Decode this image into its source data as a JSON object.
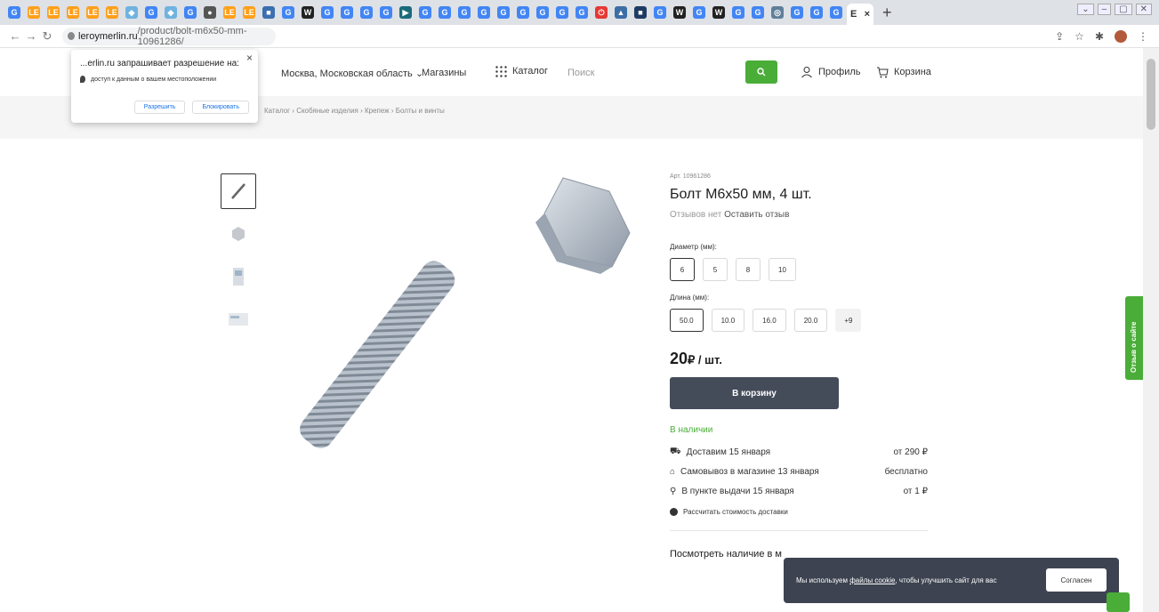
{
  "browser": {
    "tabs": [
      {
        "icon": "google-icon",
        "letter": "G",
        "color": "#4285f4"
      },
      {
        "icon": "leroy-icon",
        "letter": "LE",
        "color": "#ff9f1a"
      },
      {
        "icon": "leroy-icon",
        "letter": "LE",
        "color": "#ff9f1a"
      },
      {
        "icon": "leroy-icon",
        "letter": "LE",
        "color": "#ff9f1a"
      },
      {
        "icon": "leroy-icon",
        "letter": "LE",
        "color": "#ff9f1a"
      },
      {
        "icon": "leroy-icon",
        "letter": "LE",
        "color": "#ff9f1a"
      },
      {
        "icon": "gem-icon",
        "letter": "◆",
        "color": "#6fb3e0"
      },
      {
        "icon": "google-icon",
        "letter": "G",
        "color": "#4285f4"
      },
      {
        "icon": "gem-icon",
        "letter": "◆",
        "color": "#6fb3e0"
      },
      {
        "icon": "google-icon",
        "letter": "G",
        "color": "#4285f4"
      },
      {
        "icon": "robot-icon",
        "letter": "●",
        "color": "#555555"
      },
      {
        "icon": "leroy-icon",
        "letter": "LE",
        "color": "#ff9f1a"
      },
      {
        "icon": "leroy-icon",
        "letter": "LE",
        "color": "#ff9f1a"
      },
      {
        "icon": "box-icon",
        "letter": "■",
        "color": "#3a6fb0"
      },
      {
        "icon": "google-icon",
        "letter": "G",
        "color": "#4285f4"
      },
      {
        "icon": "bird-icon",
        "letter": "W",
        "color": "#222222"
      },
      {
        "icon": "google-icon",
        "letter": "G",
        "color": "#4285f4"
      },
      {
        "icon": "google-icon",
        "letter": "G",
        "color": "#4285f4"
      },
      {
        "icon": "google-icon",
        "letter": "G",
        "color": "#4285f4"
      },
      {
        "icon": "google-icon",
        "letter": "G",
        "color": "#4285f4"
      },
      {
        "icon": "play-icon",
        "letter": "▶",
        "color": "#1b6b7a"
      },
      {
        "icon": "google-icon",
        "letter": "G",
        "color": "#4285f4"
      },
      {
        "icon": "google-icon",
        "letter": "G",
        "color": "#4285f4"
      },
      {
        "icon": "google-icon",
        "letter": "G",
        "color": "#4285f4"
      },
      {
        "icon": "google-icon",
        "letter": "G",
        "color": "#4285f4"
      },
      {
        "icon": "google-icon",
        "letter": "G",
        "color": "#4285f4"
      },
      {
        "icon": "google-icon",
        "letter": "G",
        "color": "#4285f4"
      },
      {
        "icon": "google-icon",
        "letter": "G",
        "color": "#4285f4"
      },
      {
        "icon": "google-icon",
        "letter": "G",
        "color": "#4285f4"
      },
      {
        "icon": "google-icon",
        "letter": "G",
        "color": "#4285f4"
      },
      {
        "icon": "power-icon",
        "letter": "⏻",
        "color": "#e53935"
      },
      {
        "icon": "bank-icon",
        "letter": "▲",
        "color": "#3b6ea5"
      },
      {
        "icon": "doc-icon",
        "letter": "■",
        "color": "#1f3b63"
      },
      {
        "icon": "google-icon",
        "letter": "G",
        "color": "#4285f4"
      },
      {
        "icon": "bird-icon",
        "letter": "W",
        "color": "#222222"
      },
      {
        "icon": "google-icon",
        "letter": "G",
        "color": "#4285f4"
      },
      {
        "icon": "bird-icon",
        "letter": "W",
        "color": "#222222"
      },
      {
        "icon": "google-icon",
        "letter": "G",
        "color": "#4285f4"
      },
      {
        "icon": "google-icon",
        "letter": "G",
        "color": "#4285f4"
      },
      {
        "icon": "globe-icon",
        "letter": "◎",
        "color": "#5f7f9a"
      },
      {
        "icon": "google-icon",
        "letter": "G",
        "color": "#4285f4"
      },
      {
        "icon": "google-icon",
        "letter": "G",
        "color": "#4285f4"
      },
      {
        "icon": "google-icon",
        "letter": "G",
        "color": "#4285f4"
      }
    ],
    "active_tab_label": "E",
    "active_tab_close": "×",
    "new_tab": "+",
    "url_host": "leroymerlin.ru",
    "url_path": "/product/bolt-m6x50-mm-10961286/"
  },
  "permission_popup": {
    "title": "...erlin.ru запрашивает разрешение на:",
    "close": "×",
    "item": "доступ к данным о вашем местоположении",
    "allow": "Разрешить",
    "block": "Блокировать"
  },
  "header": {
    "location": "Москва, Московская область ⌄",
    "stores": "Магазины",
    "catalog": "Каталог",
    "search_placeholder": "Поиск",
    "profile": "Профиль",
    "cart": "Корзина"
  },
  "breadcrumbs": "Каталог  ›  Скобяные изделия  ›  Крепеж  ›  Болты и винты",
  "product": {
    "sku": "Арт. 10961286",
    "title": "Болт М6х50 мм, 4 шт.",
    "no_reviews": "Отзывов нет",
    "leave_review": "Оставить отзыв",
    "diameter_label": "Диаметр (мм):",
    "diameters": [
      "6",
      "5",
      "8",
      "10"
    ],
    "length_label": "Длина (мм):",
    "lengths": [
      "50.0",
      "10.0",
      "16.0",
      "20.0"
    ],
    "lengths_more": "+9",
    "price": "20",
    "price_unit": "₽ / шт.",
    "add_to_cart": "В корзину",
    "in_stock": "В наличии",
    "delivery": [
      {
        "label": "Доставим 15 января",
        "value": "от 290 ₽",
        "icon": "truck-icon"
      },
      {
        "label": "Самовывоз в магазине 13 января",
        "value": "бесплатно",
        "icon": "bag-icon"
      },
      {
        "label": "В пункте выдачи 15 января",
        "value": "от 1 ₽",
        "icon": "pin-icon"
      }
    ],
    "calc_delivery": "Рассчитать стоимость доставки",
    "check_stock": "Посмотреть наличие в м"
  },
  "feedback_tab": "Отзыв о сайте",
  "cookie": {
    "msg_prefix": "Мы используем ",
    "msg_link": "файлы cookie",
    "msg_suffix": ", чтобы улучшить сайт для вас",
    "accept": "Согласен"
  }
}
